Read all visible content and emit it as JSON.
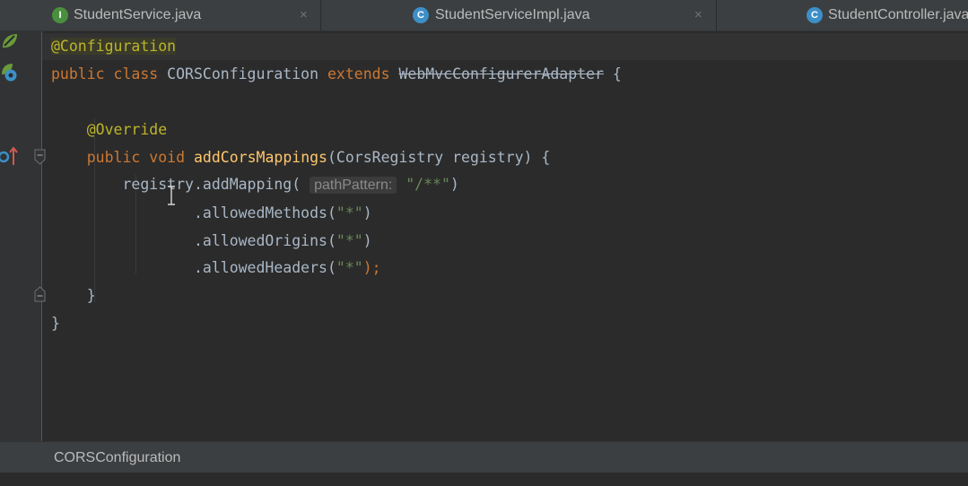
{
  "tabs": [
    {
      "label": "StudentService.java",
      "icon": "interface-icon",
      "icon_letter": "I",
      "close": "×"
    },
    {
      "label": "StudentServiceImpl.java",
      "icon": "class-icon",
      "icon_letter": "C",
      "close": "×"
    },
    {
      "label": "StudentController.java",
      "icon": "class-icon",
      "icon_letter": "C"
    }
  ],
  "code": {
    "line1": {
      "annotation": "@Configuration"
    },
    "line2": {
      "kw_public": "public",
      "kw_class": "class",
      "class_name": "CORSConfiguration",
      "kw_extends": "extends",
      "super_class": "WebMvcConfigurerAdapter",
      "brace": "{"
    },
    "line4": {
      "annotation": "@Override"
    },
    "line5": {
      "kw_public": "public",
      "kw_void": "void",
      "method": "addCorsMappings",
      "params": "(CorsRegistry registry) {"
    },
    "line6": {
      "call": "registry.addMapping(",
      "hint": "pathPattern:",
      "arg": "\"/**\"",
      "close": ")"
    },
    "line7": {
      "call": ".allowedMethods(",
      "arg": "\"*\"",
      "close": ")"
    },
    "line8": {
      "call": ".allowedOrigins(",
      "arg": "\"*\"",
      "close": ")"
    },
    "line9": {
      "call": ".allowedHeaders(",
      "arg": "\"*\"",
      "close": ");"
    },
    "line10": {
      "brace": "}"
    },
    "line11": {
      "brace": "}"
    }
  },
  "breadcrumb": {
    "label": "CORSConfiguration"
  },
  "colors": {
    "background": "#2b2b2b",
    "keyword": "#cc7832",
    "annotation": "#bbb529",
    "method": "#ffc66d",
    "string": "#6a8759",
    "text": "#a9b7c6"
  }
}
